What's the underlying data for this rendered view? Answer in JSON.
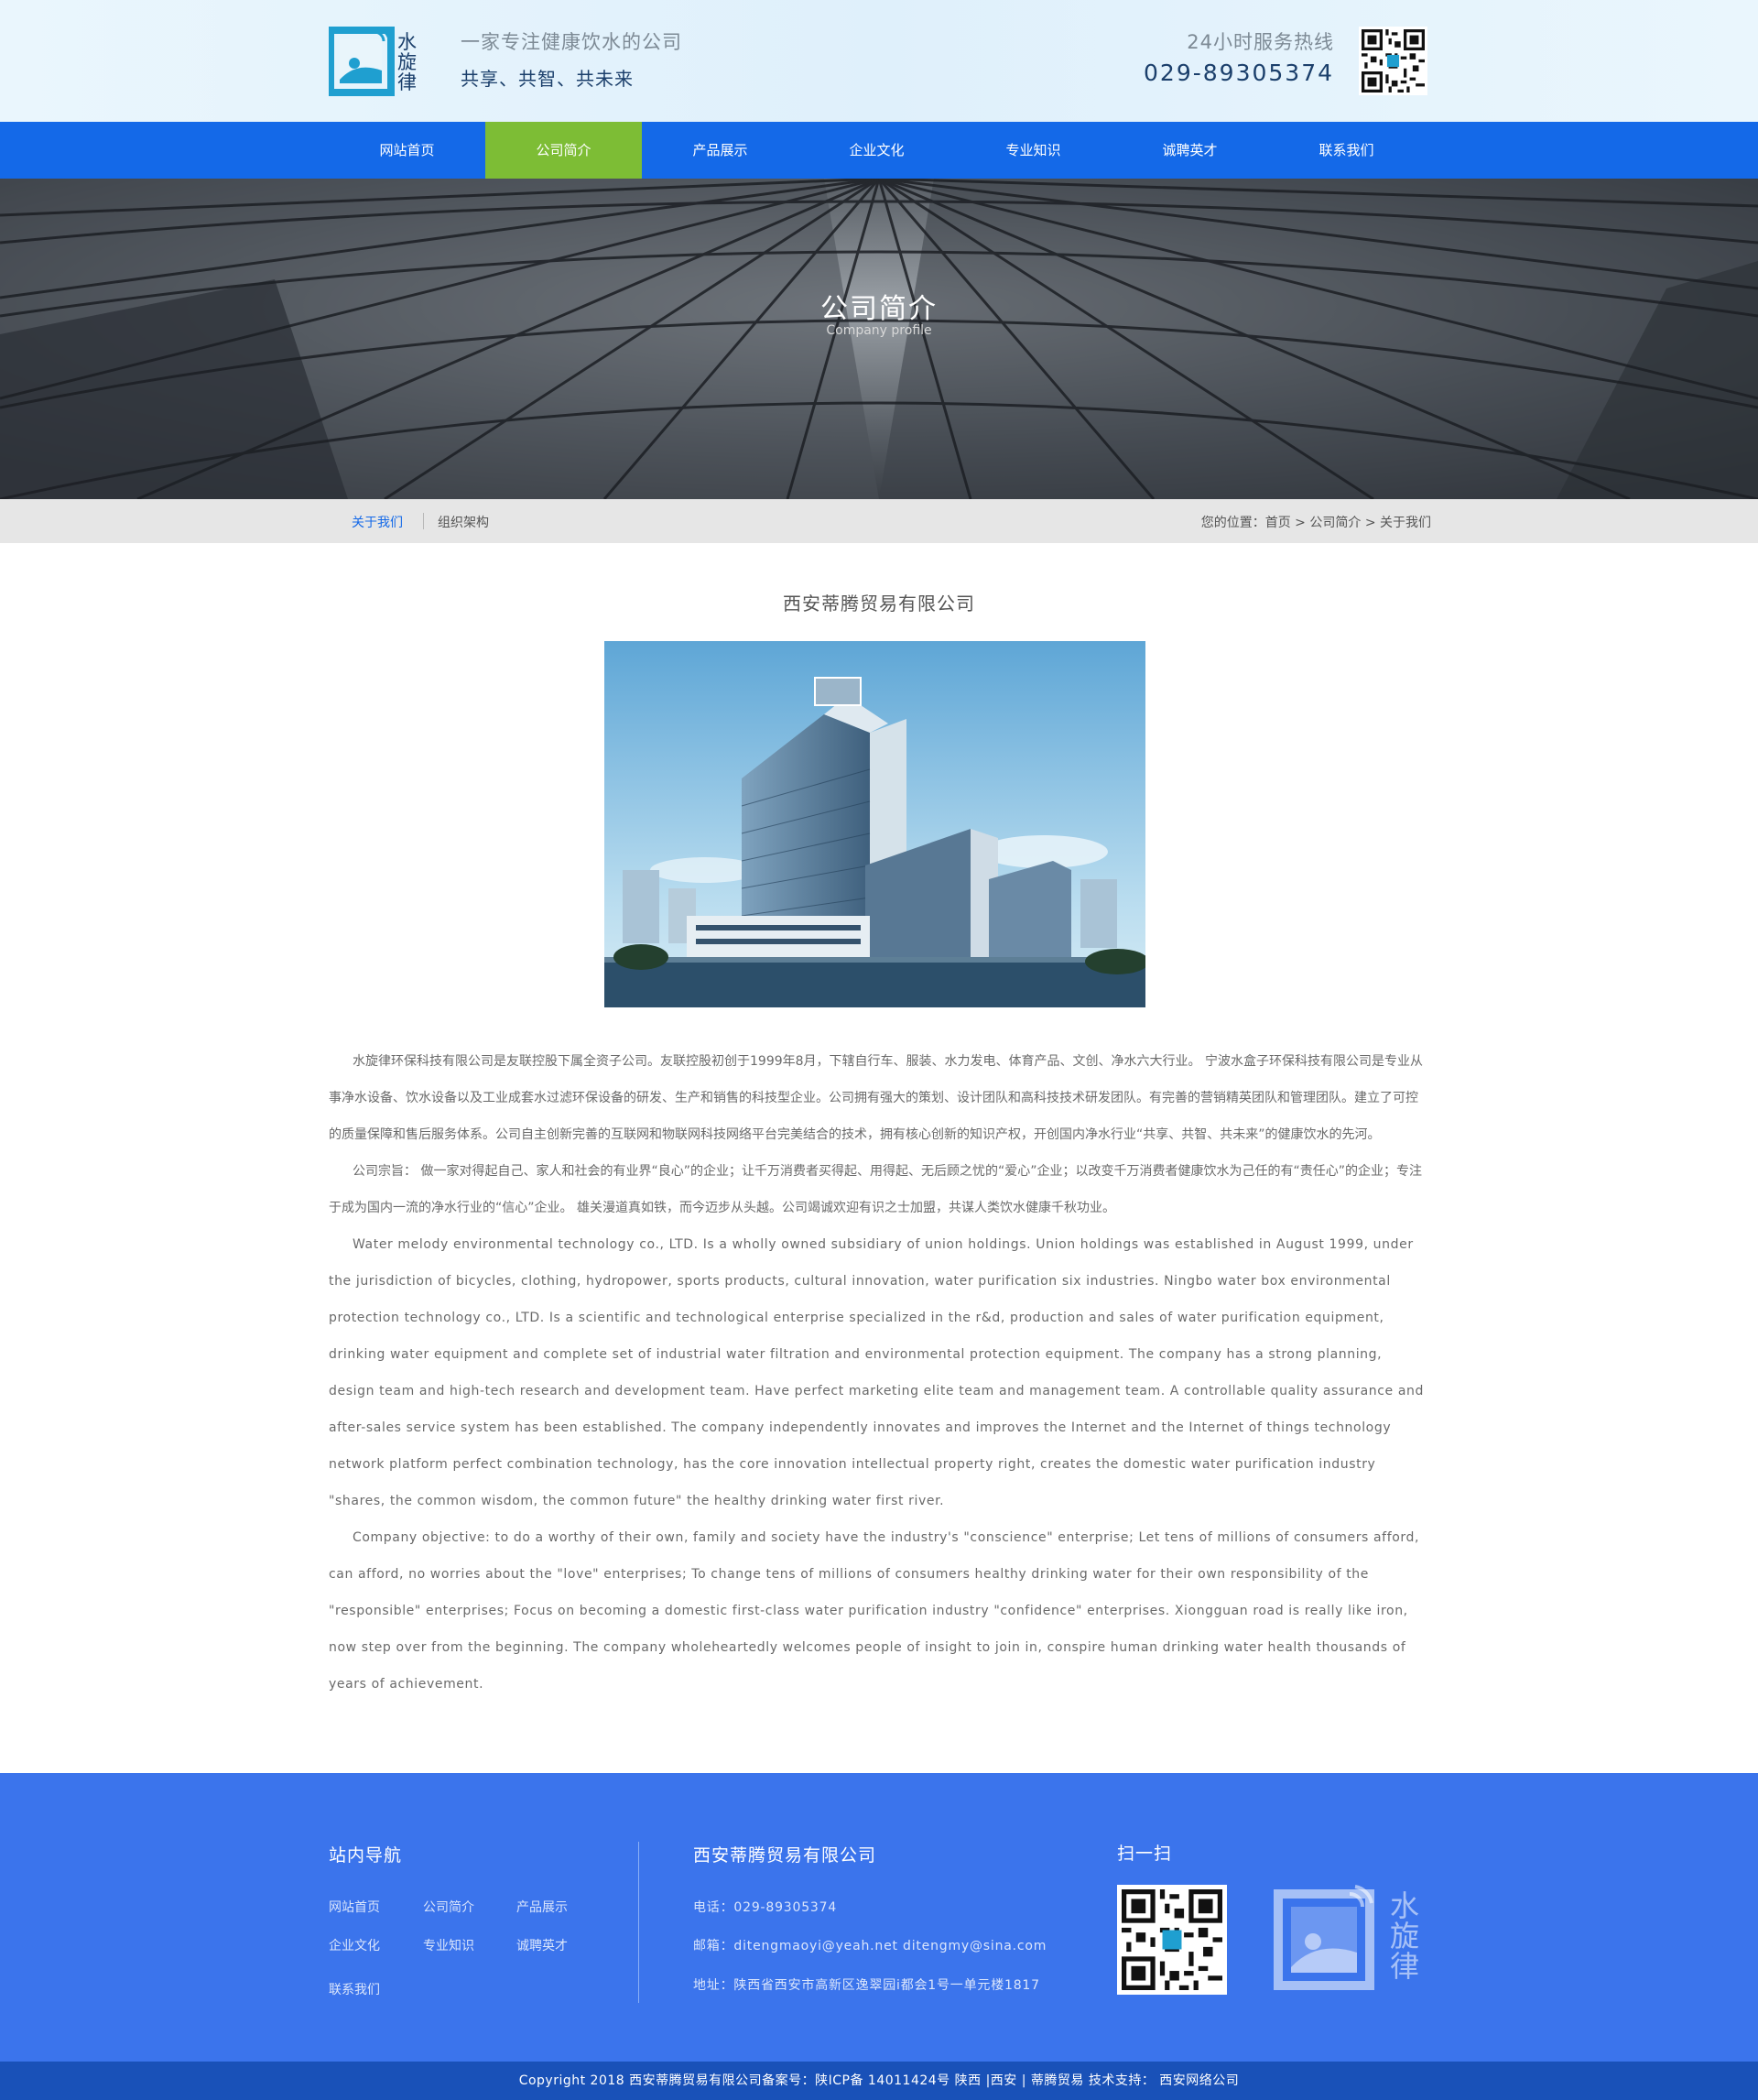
{
  "header": {
    "logo_text": "水旋律",
    "tagline": "一家专注健康饮水的公司",
    "slogan": "共享、共智、共未来",
    "hotline_label": "24小时服务热线",
    "hotline_number": "029-89305374"
  },
  "nav": {
    "items": [
      {
        "label": "网站首页"
      },
      {
        "label": "公司简介",
        "active": true
      },
      {
        "label": "产品展示"
      },
      {
        "label": "企业文化"
      },
      {
        "label": "专业知识"
      },
      {
        "label": "诚聘英才"
      },
      {
        "label": "联系我们"
      }
    ]
  },
  "banner": {
    "title": "公司简介",
    "subtitle": "Company profile"
  },
  "subnav": {
    "tab_about": "关于我们",
    "tab_org": "组织架构",
    "breadcrumb": "您的位置：首页 > 公司简介 > 关于我们"
  },
  "content": {
    "title": "西安蒂腾贸易有限公司",
    "paragraphs": [
      "水旋律环保科技有限公司是友联控股下属全资子公司。友联控股初创于1999年8月，下辖自行车、服装、水力发电、体育产品、文创、净水六大行业。 宁波水盒子环保科技有限公司是专业从事净水设备、饮水设备以及工业成套水过滤环保设备的研发、生产和销售的科技型企业。公司拥有强大的策划、设计团队和高科技技术研发团队。有完善的营销精英团队和管理团队。建立了可控的质量保障和售后服务体系。公司自主创新完善的互联网和物联网科技网络平台完美结合的技术，拥有核心创新的知识产权，开创国内净水行业“共享、共智、共未来”的健康饮水的先河。",
      "公司宗旨： 做一家对得起自己、家人和社会的有业界“良心”的企业；让千万消费者买得起、用得起、无后顾之忧的“爱心”企业；以改变千万消费者健康饮水为己任的有“责任心”的企业；专注于成为国内一流的净水行业的“信心”企业。 雄关漫道真如铁，而今迈步从头越。公司竭诚欢迎有识之士加盟，共谋人类饮水健康千秋功业。",
      "Water melody environmental technology co., LTD. Is a wholly owned subsidiary of union holdings. Union holdings was established in August 1999, under the jurisdiction of bicycles, clothing, hydropower, sports products, cultural innovation, water purification six industries. Ningbo water box environmental protection technology co., LTD. Is a scientific and technological enterprise specialized in the r&d, production and sales of water purification equipment, drinking water equipment and complete set of industrial water filtration and environmental protection equipment. The company has a strong planning, design team and high-tech research and development team. Have perfect marketing elite team and management team. A controllable quality assurance and after-sales service system has been established. The company independently innovates and improves the Internet and the Internet of things technology network platform perfect combination technology, has the core innovation intellectual property right, creates the domestic water purification industry \"shares, the common wisdom, the common future\" the healthy drinking water first river.",
      "Company objective: to do a worthy of their own, family and society have the industry's \"conscience\" enterprise; Let tens of millions of consumers afford, can afford, no worries about the \"love\" enterprises; To change tens of millions of consumers healthy drinking water for their own responsibility of the \"responsible\" enterprises; Focus on becoming a domestic first-class water purification industry \"confidence\" enterprises. Xiongguan road is really like iron, now step over from the beginning. The company wholeheartedly welcomes people of insight to join in, conspire human drinking water health thousands of years of achievement."
    ]
  },
  "footer": {
    "nav_title": "站内导航",
    "links": [
      "网站首页",
      "公司简介",
      "产品展示",
      "企业文化",
      "专业知识",
      "诚聘英才",
      "联系我们"
    ],
    "company_title": "西安蒂腾贸易有限公司",
    "phone": "电话：029-89305374",
    "email": "邮箱：ditengmaoyi@yeah.net   ditengmy@sina.com",
    "address": "地址：陕西省西安市高新区逸翠园i都会1号一单元楼1817",
    "scan_title": "扫一扫",
    "logo_text": "水旋律",
    "copyright": "Copyright   2018 西安蒂腾贸易有限公司备案号：陕ICP备 14011424号     陕西 |西安 |   蒂腾贸易     技术支持：  西安网络公司"
  },
  "colors": {
    "primary_blue": "#1469e8",
    "nav_active_green": "#7dbd35",
    "footer_blue": "#3b74ec",
    "copyright_blue": "#1951b8"
  }
}
